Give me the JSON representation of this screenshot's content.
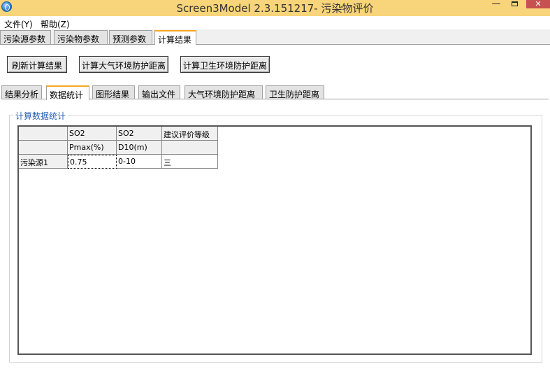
{
  "window": {
    "title": "Screen3Model 2.3.151217- 污染物评价",
    "min_glyph": "—",
    "close_glyph": "✕"
  },
  "menu": [
    "文件(Y)",
    "帮助(Z)"
  ],
  "main_tabs": [
    "污染源参数",
    "污染物参数",
    "预测参数",
    "计算结果"
  ],
  "actions": {
    "refresh": "刷新计算结果",
    "atmos": "计算大气环境防护距离",
    "sanitary": "计算卫生环境防护距离"
  },
  "sub_tabs": [
    "结果分析",
    "数据统计",
    "图形结果",
    "输出文件",
    "大气环境防护距离",
    "卫生防护距离"
  ],
  "group_title": "计算数据统计",
  "table": {
    "header_row1": [
      "",
      "SO2",
      "SO2",
      "建议评价等级"
    ],
    "header_row2": [
      "",
      "Pmax(%)",
      "D10(m)",
      ""
    ],
    "rows": [
      {
        "source": "污染源1",
        "pmax": "0.75",
        "d10": "0-10",
        "level": "三"
      }
    ]
  }
}
